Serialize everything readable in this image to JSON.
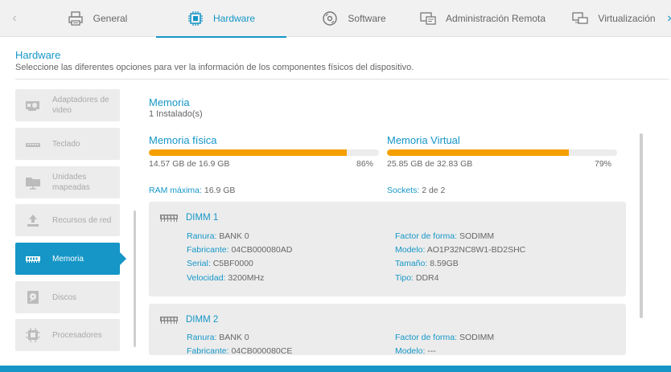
{
  "colors": {
    "accent": "#1596c7",
    "progress": "#f5a000",
    "card_bg": "#ececec",
    "tab_bg": "#f1f1f1"
  },
  "tabs": [
    {
      "label": "General",
      "icon": "printer-icon",
      "active": false
    },
    {
      "label": "Hardware",
      "icon": "chip-icon",
      "active": true
    },
    {
      "label": "Software",
      "icon": "disc-icon",
      "active": false
    },
    {
      "label": "Administración Remota",
      "icon": "remote-desktop-icon",
      "active": false
    },
    {
      "label": "Virtualización",
      "icon": "virtual-machine-icon",
      "active": false
    }
  ],
  "header": {
    "title": "Hardware",
    "description": "Seleccione las diferentes opciones para ver la información de los componentes físicos del dispositivo."
  },
  "sidebar": {
    "items": [
      {
        "label": "Adaptadores de video",
        "icon": "video-card-icon",
        "active": false
      },
      {
        "label": "Teclado",
        "icon": "keyboard-icon",
        "active": false
      },
      {
        "label": "Unidades mapeadas",
        "icon": "folder-network-icon",
        "active": false
      },
      {
        "label": "Recursos de red",
        "icon": "upload-icon",
        "active": false
      },
      {
        "label": "Memoria",
        "icon": "memory-icon",
        "active": true
      },
      {
        "label": "Discos",
        "icon": "hard-disk-icon",
        "active": false
      },
      {
        "label": "Procesadores",
        "icon": "processor-icon",
        "active": false
      }
    ]
  },
  "memory": {
    "title": "Memoria",
    "installed": "1 Instalado(s)",
    "physical": {
      "title": "Memoria física",
      "detail": "14.57 GB de 16.9 GB",
      "percent_label": "86%",
      "percent": 86
    },
    "virtual": {
      "title": "Memoria Virtual",
      "detail": "25.85 GB de 32.83 GB",
      "percent_label": "79%",
      "percent": 79
    },
    "ram_max": {
      "label": "RAM máxima:",
      "value": "16.9 GB"
    },
    "sockets": {
      "label": "Sockets:",
      "value": "2 de 2"
    }
  },
  "dimms": [
    {
      "name": "DIMM 1",
      "left": [
        {
          "label": "Ranura:",
          "value": "BANK 0"
        },
        {
          "label": "Fabricante:",
          "value": "04CB000080AD"
        },
        {
          "label": "Serial:",
          "value": "C5BF0000"
        },
        {
          "label": "Velocidad:",
          "value": "3200MHz"
        }
      ],
      "right": [
        {
          "label": "Factor de forma:",
          "value": "SODIMM"
        },
        {
          "label": "Modelo:",
          "value": "AO1P32NC8W1-BD2SHC"
        },
        {
          "label": "Tamaño:",
          "value": "8.59GB"
        },
        {
          "label": "Tipo:",
          "value": "DDR4"
        }
      ]
    },
    {
      "name": "DIMM 2",
      "left": [
        {
          "label": "Ranura:",
          "value": "BANK 0"
        },
        {
          "label": "Fabricante:",
          "value": "04CB000080CE"
        }
      ],
      "right": [
        {
          "label": "Factor de forma:",
          "value": "SODIMM"
        },
        {
          "label": "Modelo:",
          "value": "---"
        }
      ]
    }
  ]
}
